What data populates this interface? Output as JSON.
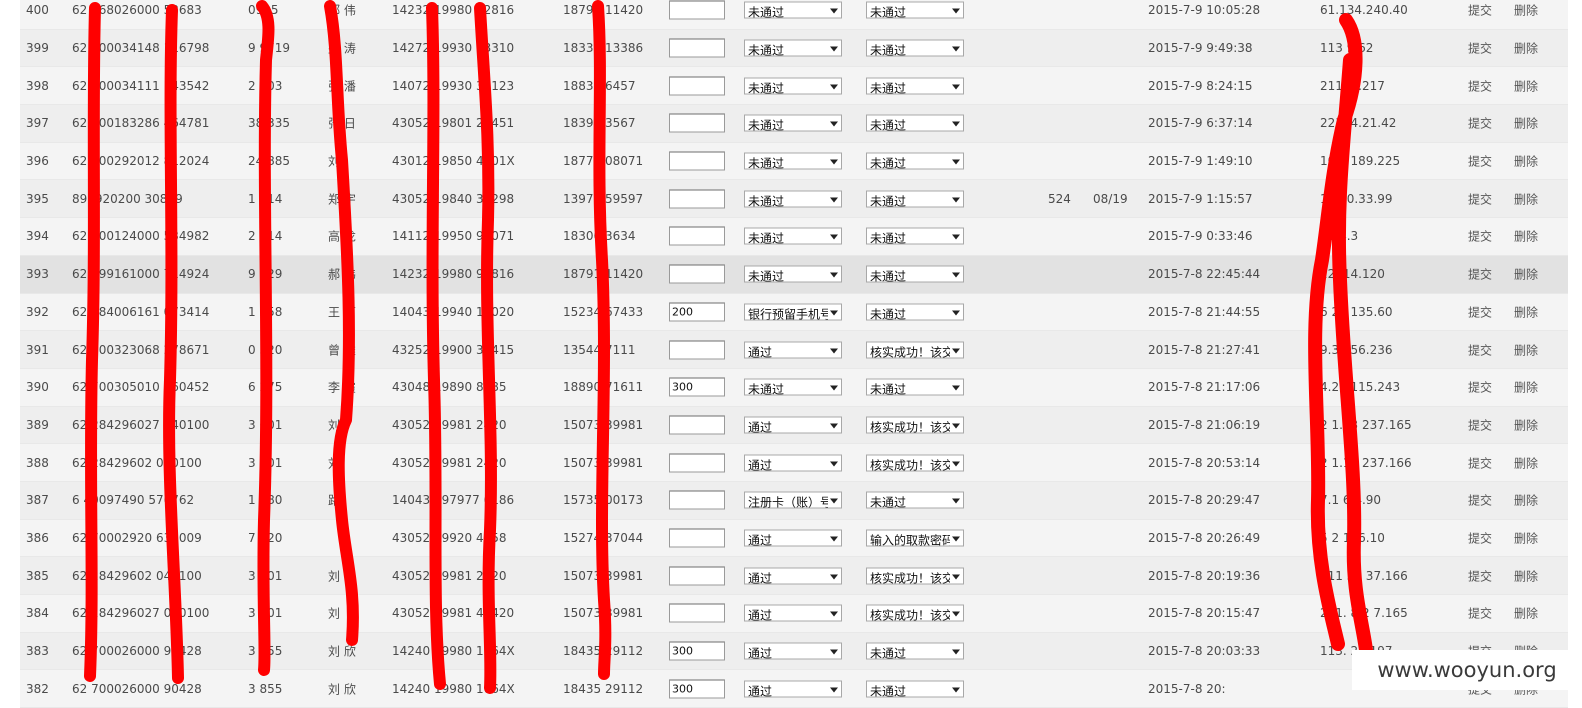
{
  "rows": [
    {
      "id": "400",
      "card": "62 668026000 53683",
      "cvv": "  0905",
      "name": "郝 伟",
      "idno": "14232 19980 92816",
      "phone": "18797 11420",
      "amount": "",
      "status": "未通过",
      "result": "未通过",
      "extra1": "",
      "extra2": "",
      "time": "2015-7-9 10:05:28",
      "ip": "61.134.240.40",
      "submit": "提交",
      "delete": "删除",
      "hl": false
    },
    {
      "id": "399",
      "card": "62 700034148 116798",
      "cvv": "9 9719",
      "name": "盛 涛",
      "idno": "14272 19930 93310",
      "phone": "18334 13386",
      "amount": "",
      "status": "未通过",
      "result": "未通过",
      "extra1": "",
      "extra2": "",
      "time": "2015-7-9 9:49:38",
      "ip": "113 9.62",
      "submit": "提交",
      "delete": "删除",
      "hl": false
    },
    {
      "id": "398",
      "card": "62 700034111 143542",
      "cvv": "2 603",
      "name": "张 潘",
      "idno": "14072 19930 30123",
      "phone": "1883 96457",
      "amount": "",
      "status": "未通过",
      "result": "未通过",
      "extra1": "",
      "extra2": "",
      "time": "2015-7-9 8:24:15",
      "ip": "211. 7.217",
      "submit": "提交",
      "delete": "删除",
      "hl": false
    },
    {
      "id": "397",
      "card": "62 700183286 464781",
      "cvv": "38 335",
      "name": "张 日",
      "idno": "43052 19801 21451",
      "phone": "1839 63567",
      "amount": "",
      "status": "未通过",
      "result": "未通过",
      "extra1": "",
      "extra2": "",
      "time": "2015-7-9 6:37:14",
      "ip": "223. 4.21.42",
      "submit": "提交",
      "delete": "删除",
      "hl": false
    },
    {
      "id": "396",
      "card": "62 700292012 812024",
      "cvv": "24 885",
      "name": "刘",
      "idno": "43012 19850 4101X",
      "phone": "18774 08071",
      "amount": "",
      "status": "未通过",
      "result": "未通过",
      "extra1": "",
      "extra2": "",
      "time": "2015-7-9 1:49:10",
      "ip": "106. 189.225",
      "submit": "提交",
      "delete": "删除",
      "hl": false
    },
    {
      "id": "395",
      "card": " 895920200 30869",
      "cvv": "1 814",
      "name": "郑 宇",
      "idno": "43052 19840 34298",
      "phone": "13975 59597",
      "amount": "",
      "status": "未通过",
      "result": "未通过",
      "extra1": "524",
      "extra2": "08/19",
      "time": "2015-7-9 1:15:57",
      "ip": "124 0.33.99",
      "submit": "提交",
      "delete": "删除",
      "hl": false
    },
    {
      "id": "394",
      "card": "62 700124000 534982",
      "cvv": "2 114",
      "name": "高 龙",
      "idno": "14112 19950 90071",
      "phone": "18306 3634",
      "amount": "",
      "status": "未通过",
      "result": "未通过",
      "extra1": "",
      "extra2": "",
      "time": "2015-7-9 0:33:46",
      "ip": " 36.4.3",
      "submit": "提交",
      "delete": "删除",
      "hl": false
    },
    {
      "id": "393",
      "card": "62 799161000 714924",
      "cvv": "9 829",
      "name": "郝 伟",
      "idno": "14232 19980 92816",
      "phone": "18791 11420",
      "amount": "",
      "status": "未通过",
      "result": "未通过",
      "extra1": "",
      "extra2": "",
      "time": "2015-7-8 22:45:44",
      "ip": "22 .14.120",
      "submit": "提交",
      "delete": "删除",
      "hl": true
    },
    {
      "id": "392",
      "card": "62 284006161 073414",
      "cvv": "1 258",
      "name": "王 可",
      "idno": "14043 19940 10020",
      "phone": "15234 67433",
      "amount": "200",
      "status": "银行预留手机号",
      "result": "未通过",
      "extra1": "",
      "extra2": "",
      "time": "2015-7-8 21:44:55",
      "ip": "6 22 135.60",
      "submit": "提交",
      "delete": "删除",
      "hl": false
    },
    {
      "id": "391",
      "card": "62 700323068 278671",
      "cvv": "0 320",
      "name": "曾 雄",
      "idno": "43252 19900 31415",
      "phone": "13544 7111",
      "amount": "",
      "status": "通过",
      "result": "核实成功！该交",
      "extra1": "",
      "extra2": "",
      "time": "2015-7-8 21:27:41",
      "ip": "9.39 56.236",
      "submit": "提交",
      "delete": "删除",
      "hl": false
    },
    {
      "id": "390",
      "card": "62 700305010 560452",
      "cvv": "6 275",
      "name": "李 霞",
      "idno": "43048 19890 8785",
      "phone": "18890 71611",
      "amount": "300",
      "status": "未通过",
      "result": "未通过",
      "extra1": "",
      "extra2": "",
      "time": "2015-7-8 21:17:06",
      "ip": " 4.23 115.243",
      "submit": "提交",
      "delete": "删除",
      "hl": false
    },
    {
      "id": "389",
      "card": "62 284296027 040100",
      "cvv": "3 601",
      "name": "刘",
      "idno": "43052 19981 2420",
      "phone": "15073 39981",
      "amount": "",
      "status": "通过",
      "result": "核实成功！该交",
      "extra1": "",
      "extra2": "",
      "time": "2015-7-8 21:06:19",
      "ip": "2 1.13 237.165",
      "submit": "提交",
      "delete": "删除",
      "hl": false
    },
    {
      "id": "388",
      "card": "62 28429602 040100",
      "cvv": "3 601",
      "name": "刘",
      "idno": "43052 19981 2420",
      "phone": "15073 39981",
      "amount": "",
      "status": "通过",
      "result": "核实成功！该交",
      "extra1": "",
      "extra2": "",
      "time": "2015-7-8 20:53:14",
      "ip": "2 1.13 237.166",
      "submit": "提交",
      "delete": "删除",
      "hl": false
    },
    {
      "id": "387",
      "card": "6 40097490 576762",
      "cvv": "1 880",
      "name": "路",
      "idno": "14043 197977 6186",
      "phone": "15735 00173",
      "amount": "",
      "status": "注册卡（账）号",
      "result": "未通过",
      "extra1": "",
      "extra2": "",
      "time": "2015-7-8 20:29:47",
      "ip": "7.1 6.4.90",
      "submit": "提交",
      "delete": "删除",
      "hl": false
    },
    {
      "id": "386",
      "card": "62 70002920 632009",
      "cvv": "7 520",
      "name": "",
      "idno": "43052 19920 4958",
      "phone": "15274 37044",
      "amount": "",
      "status": "通过",
      "result": "输入的取款密码",
      "extra1": "",
      "extra2": "",
      "time": "2015-7-8 20:26:49",
      "ip": "5 2 136.10",
      "submit": "提交",
      "delete": "删除",
      "hl": false
    },
    {
      "id": "385",
      "card": "62 28429602 040100",
      "cvv": "3 601",
      "name": "刘",
      "idno": "43052 19981 2420",
      "phone": "15073 39981",
      "amount": "",
      "status": "通过",
      "result": "核实成功！该交",
      "extra1": "",
      "extra2": "",
      "time": "2015-7-8 20:19:36",
      "ip": "211 38 37.166",
      "submit": "提交",
      "delete": "删除",
      "hl": false
    },
    {
      "id": "384",
      "card": "62 284296027 040100",
      "cvv": "3 601",
      "name": "刘",
      "idno": "43052 19981 42420",
      "phone": "15073 39981",
      "amount": "",
      "status": "通过",
      "result": "核实成功！该交",
      "extra1": "",
      "extra2": "",
      "time": "2015-7-8 20:15:47",
      "ip": "211. 8.2 7.165",
      "submit": "提交",
      "delete": "删除",
      "hl": false
    },
    {
      "id": "383",
      "card": "62 700026000 90428",
      "cvv": "3 855",
      "name": "刘 欣",
      "idno": "14240 19980 1064X",
      "phone": "18435 29112",
      "amount": "300",
      "status": "通过",
      "result": "未通过",
      "extra1": "",
      "extra2": "",
      "time": "2015-7-8 20:03:33",
      "ip": "113. 21 197",
      "submit": "提交",
      "delete": "删除",
      "hl": false
    },
    {
      "id": "382",
      "card": "62 700026000 90428",
      "cvv": "3 855",
      "name": "刘 欣",
      "idno": "14240 19980 1064X",
      "phone": "18435 29112",
      "amount": "300",
      "status": "通过",
      "result": "未通过",
      "extra1": "",
      "extra2": "",
      "time": "2015-7-8 20:",
      "ip": "",
      "submit": "提交",
      "delete": "删除",
      "hl": false
    }
  ],
  "watermark": "www.wooyun.org",
  "colors": {
    "redaction": "#ff0000",
    "row_bg": "#f4f4f4",
    "row_alt_bg": "#eeeeee",
    "row_highlight_bg": "#e2e2e2"
  }
}
